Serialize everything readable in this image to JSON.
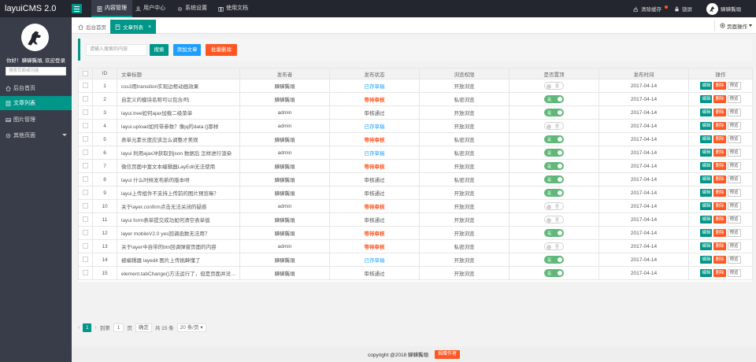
{
  "app": {
    "title": "layuiCMS 2.0"
  },
  "topnav": [
    {
      "label": "内容管理",
      "icon": "textfile-icon",
      "active": true
    },
    {
      "label": "用户中心",
      "icon": "users-icon",
      "active": false
    },
    {
      "label": "系统设置",
      "icon": "gear-icon",
      "active": false
    },
    {
      "label": "使用文档",
      "icon": "book-icon",
      "active": false
    }
  ],
  "topright": {
    "clear_cache": "清除缓存",
    "lock": "锁屏",
    "username": "驊驊龔頑"
  },
  "sidebar": {
    "greeting": "你好！驊驊龔頑, 欢迎登录",
    "search_placeholder": "搜索页面或功能",
    "items": [
      {
        "label": "后台首页",
        "icon": "home-icon"
      },
      {
        "label": "文章列表",
        "icon": "article-icon",
        "active": true
      },
      {
        "label": "图片管理",
        "icon": "image-icon"
      },
      {
        "label": "其他页面",
        "icon": "more-icon"
      }
    ]
  },
  "tabs": {
    "home": "后台首页",
    "current": "文章列表",
    "close": "×",
    "page_ops": "页面操作"
  },
  "toolbar": {
    "search_placeholder": "请输入搜索的内容",
    "search_label": "搜索",
    "add_label": "添加文章",
    "batch_delete_label": "批量删除"
  },
  "table": {
    "headers": [
      "",
      "ID",
      "文章标题",
      "发布者",
      "发布状态",
      "浏览权限",
      "是否置顶",
      "发布时间",
      "操作"
    ],
    "switch_on": "是",
    "switch_off": "否",
    "op_labels": {
      "edit": "编辑",
      "delete": "删除",
      "view": "预览"
    },
    "rows": [
      {
        "id": "1",
        "title": "css3用transition实现边框动画效果",
        "author": "驊驊龔頑",
        "status": "已存草稿",
        "status_type": "draft",
        "perm": "开放浏览",
        "top": false,
        "date": "2017-04-14"
      },
      {
        "id": "2",
        "title": "自定义的模块名称可以包含/吗",
        "author": "驊驊龔頑",
        "status": "等待审核",
        "status_type": "pending",
        "perm": "私密浏览",
        "top": true,
        "date": "2017-04-14"
      },
      {
        "id": "3",
        "title": "layui.tree如何ajax加载二级菜单",
        "author": "admin",
        "status": "审核通过",
        "status_type": "pass",
        "perm": "开放浏览",
        "top": true,
        "date": "2017-04-14"
      },
      {
        "id": "4",
        "title": "layui.upload如何带参数？像jq的data:{}那样",
        "author": "admin",
        "status": "已存草稿",
        "status_type": "draft",
        "perm": "开放浏览",
        "top": false,
        "date": "2017-04-14"
      },
      {
        "id": "5",
        "title": "表单元素长度应该怎么调整才美观",
        "author": "驊驊龔頑",
        "status": "等待审核",
        "status_type": "pending",
        "perm": "私密浏览",
        "top": true,
        "date": "2017-04-14"
      },
      {
        "id": "6",
        "title": "layui 利用ajax冲获取到json 数据后 怎样进行渲染",
        "author": "admin",
        "status": "已存草稿",
        "status_type": "draft",
        "perm": "私密浏览",
        "top": true,
        "date": "2017-04-14"
      },
      {
        "id": "7",
        "title": "微信页面中富文本编辑器LayEdit无法使用",
        "author": "驊驊龔頑",
        "status": "等待审核",
        "status_type": "pending",
        "perm": "开放浏览",
        "top": true,
        "date": "2017-04-14"
      },
      {
        "id": "8",
        "title": "layui 什么时候发布新的版本呀",
        "author": "驊驊龔頑",
        "status": "审核通过",
        "status_type": "pass",
        "perm": "私密浏览",
        "top": true,
        "date": "2017-04-14"
      },
      {
        "id": "9",
        "title": "layui上传组件不支持上传前的图片预览嘛？",
        "author": "驊驊龔頑",
        "status": "审核通过",
        "status_type": "pass",
        "perm": "开放浏览",
        "top": true,
        "date": "2017-04-14"
      },
      {
        "id": "10",
        "title": "关于layer.confirm点击无法关闭的疑惑",
        "author": "admin",
        "status": "等待审核",
        "status_type": "pending",
        "perm": "开放浏览",
        "top": false,
        "date": "2017-04-14"
      },
      {
        "id": "11",
        "title": "layui form表单提交成功如何清空表单值",
        "author": "驊驊龔頑",
        "status": "审核通过",
        "status_type": "pass",
        "perm": "开放浏览",
        "top": false,
        "date": "2017-04-14"
      },
      {
        "id": "12",
        "title": "layer mobileV2.0 yes回调函数无法用？",
        "author": "驊驊龔頑",
        "status": "等待审核",
        "status_type": "pending",
        "perm": "开放浏览",
        "top": true,
        "date": "2017-04-14"
      },
      {
        "id": "13",
        "title": "关于layer中自带的btn回调弹窗页面的内容",
        "author": "admin",
        "status": "等待审核",
        "status_type": "pending",
        "perm": "私密浏览",
        "top": false,
        "date": "2017-04-14"
      },
      {
        "id": "14",
        "title": "被编辑器 layedit 图片上传挑衅懂了",
        "author": "驊驊龔頑",
        "status": "已存草稿",
        "status_type": "draft",
        "perm": "开放浏览",
        "top": true,
        "date": "2017-04-14"
      },
      {
        "id": "15",
        "title": "element.tabChange()方法运行了，但是页面并没有切换",
        "author": "驊驊龔頑",
        "status": "审核通过",
        "status_type": "pass",
        "perm": "开放浏览",
        "top": true,
        "date": "2017-04-14"
      }
    ]
  },
  "pager": {
    "current": "1",
    "goto_label": "到第",
    "goto_value": "1",
    "page_unit": "页",
    "confirm": "确定",
    "total": "共 15 条",
    "per_page": "20 条/页"
  },
  "footer": {
    "copyright": "copyright @2018 驊驊龔頑",
    "donate_label": "捐赠作者"
  }
}
